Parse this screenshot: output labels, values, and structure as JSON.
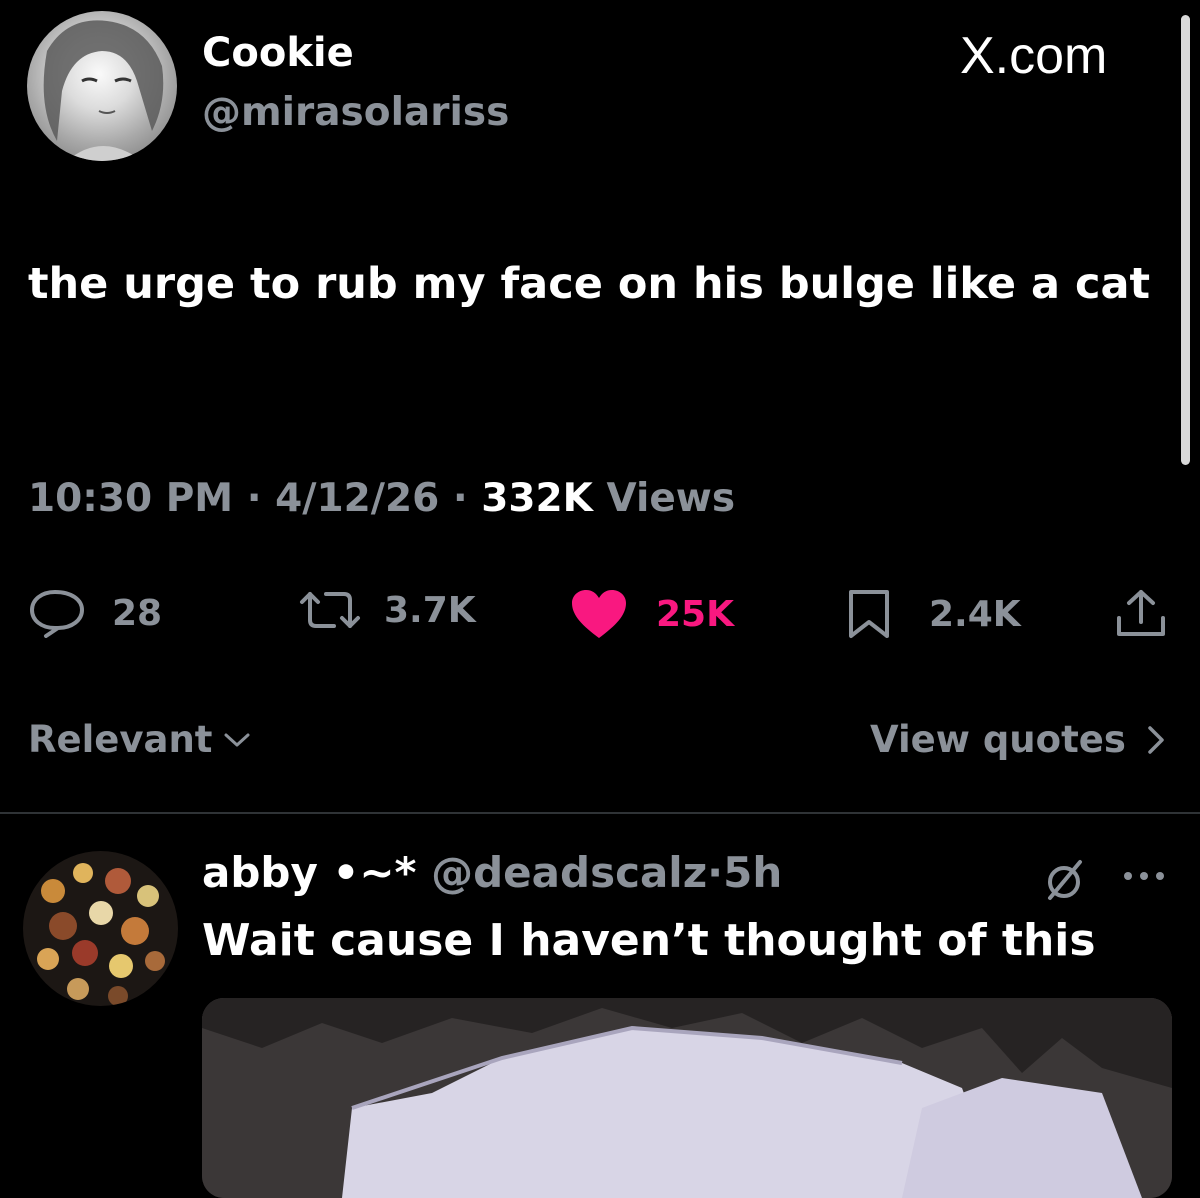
{
  "tweet": {
    "author": {
      "name": "Cookie",
      "handle": "@mirasolariss"
    },
    "brand": "X.com",
    "text": "the urge to rub my face on his bulge like a cat",
    "time": "10:30 PM",
    "date": "4/12/26",
    "views_count": "332K",
    "views_label": "Views",
    "separator": "·",
    "actions": {
      "replies": "28",
      "reposts": "3.7K",
      "likes": "25K",
      "bookmarks": "2.4K"
    },
    "sort_label": "Relevant",
    "view_quotes_label": "View quotes"
  },
  "reply": {
    "name": "abby •~*",
    "handle": "@deadscalz",
    "time": "5h",
    "separator": "·",
    "text": "Wait cause I haven’t thought of this"
  },
  "icons": {
    "reply": "speech-bubble-icon",
    "repost": "repost-arrows-icon",
    "like": "heart-icon",
    "bookmark": "bookmark-icon",
    "share": "share-upload-icon",
    "sort": "chevron-down-icon",
    "quotes": "chevron-right-icon",
    "mute": "mute-slash-icon",
    "more": "more-dots-icon"
  },
  "colors": {
    "background": "#000000",
    "text": "#ffffff",
    "secondary_text": "#8b9199",
    "like_pink": "#f91880",
    "divider": "#2f3336"
  }
}
